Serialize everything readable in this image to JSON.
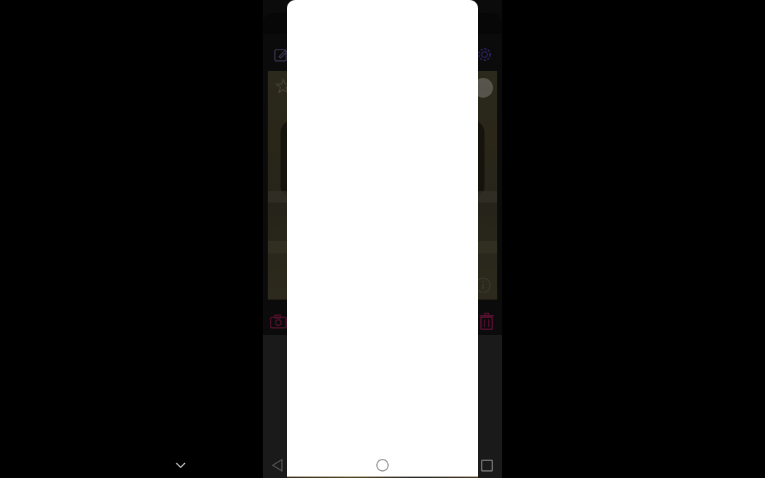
{
  "app": {
    "accent_color": "#5b3fc4",
    "delete_color": "#c2185b",
    "camera_color": "#c2185b"
  },
  "toolbar": {
    "edit_icon": "edit-icon",
    "settings_icon": "gear-icon"
  },
  "photo": {
    "favorite_icon": "star-icon",
    "badge_icon": "cup-icon",
    "info_icon": "info-icon"
  },
  "actions": {
    "camera_icon": "camera-icon",
    "delete_icon": "trash-icon"
  },
  "sheet": {
    "state": "blank"
  },
  "navbar": {
    "back_icon": "triangle-back-icon",
    "home_icon": "circle-home-icon",
    "recents_icon": "square-recents-icon",
    "collapse_icon": "chevron-down-icon"
  }
}
